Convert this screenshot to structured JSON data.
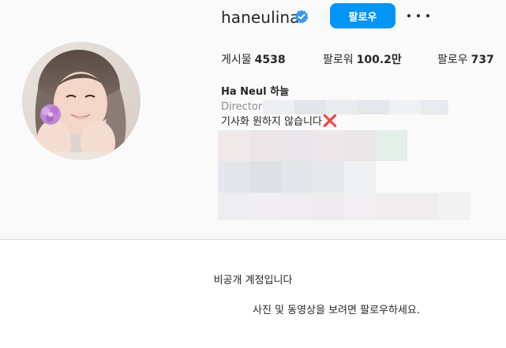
{
  "profile": {
    "username": "haneulina",
    "follow_label": "팔로우",
    "more_icon": "more-horizontal-icon",
    "verified_icon": "verified-badge-icon",
    "stats": [
      {
        "label": "게시물",
        "value": "4538"
      },
      {
        "label": "팔로워",
        "value": "100.2만"
      },
      {
        "label": "팔로우",
        "value": "737"
      }
    ],
    "full_name": "Ha Neul 하늘",
    "category": "Director",
    "bio_line": "기사화 원하지 않습니다",
    "bio_emoji": "❌"
  },
  "private_notice": {
    "title": "비공개 계정입니다",
    "description": "사진 및 동영상을 보려면 팔로우하세요."
  },
  "colors": {
    "accent": "#0095f6",
    "verified": "#3897f0",
    "cross": "#d7264e",
    "divider": "#dbdbdb"
  }
}
